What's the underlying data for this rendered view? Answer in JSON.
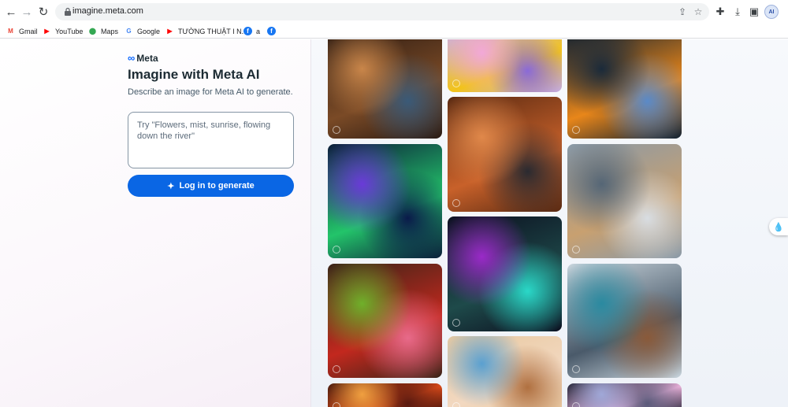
{
  "browser": {
    "url": "imagine.meta.com",
    "bookmarks": [
      {
        "label": "Gmail",
        "icon": "gmail-icon",
        "color": "#ea4335",
        "glyph": "M"
      },
      {
        "label": "YouTube",
        "icon": "youtube-icon",
        "color": "#ff0000",
        "glyph": "▶"
      },
      {
        "label": "Maps",
        "icon": "maps-icon",
        "color": "#34a853",
        "glyph": "⬤"
      },
      {
        "label": "Google",
        "icon": "google-icon",
        "color": "#4285f4",
        "glyph": "G"
      },
      {
        "label": "TƯỜNG THUẬT I N...",
        "icon": "youtube-icon",
        "color": "#ff0000",
        "glyph": "▶"
      },
      {
        "label": "a",
        "icon": "facebook-icon",
        "color": "#1877f2",
        "glyph": "f"
      },
      {
        "label": "",
        "icon": "facebook-icon",
        "color": "#1877f2",
        "glyph": "f"
      }
    ]
  },
  "left_panel": {
    "brand": "Meta",
    "title": "Imagine with Meta AI",
    "subtitle": "Describe an image for Meta AI to generate.",
    "prompt_placeholder": "Try \"Flowers, mist, sunrise, flowing down the river\"",
    "login_button": "Log in to generate"
  },
  "gallery": {
    "items": [
      {
        "subject": "library",
        "colors": [
          "#2a1a12",
          "#7a4a26",
          "#c9864a",
          "#3a5a78"
        ]
      },
      {
        "subject": "aurora",
        "colors": [
          "#0b1e3a",
          "#23c46a",
          "#6a3ad8",
          "#0a1a4a"
        ]
      },
      {
        "subject": "fruit platter",
        "colors": [
          "#3a2418",
          "#c2281e",
          "#6fb02a",
          "#e86a8a"
        ]
      },
      {
        "subject": "lanterns",
        "colors": [
          "#3a0e08",
          "#d84a1a",
          "#f0a040",
          "#5a1a10"
        ]
      },
      {
        "subject": "ducks",
        "colors": [
          "#c8b0e6",
          "#f2c31a",
          "#f2a8d8",
          "#8a6ad8"
        ]
      },
      {
        "subject": "desert car",
        "colors": [
          "#5a2a12",
          "#c8612a",
          "#e0884a",
          "#2a2a30"
        ]
      },
      {
        "subject": "astronauts",
        "colors": [
          "#0c1020",
          "#1e4a4a",
          "#9a2ac8",
          "#2ad8c8"
        ]
      },
      {
        "subject": "bird character",
        "colors": [
          "#e9c9a0",
          "#f2d8c0",
          "#5aa0d0",
          "#b07040"
        ]
      },
      {
        "subject": "butterfly",
        "colors": [
          "#102030",
          "#e8861a",
          "#1a2a3a",
          "#5a8ac8"
        ]
      },
      {
        "subject": "dog in water",
        "colors": [
          "#8a9aa8",
          "#c8a070",
          "#556676",
          "#d8dde2"
        ]
      },
      {
        "subject": "city car",
        "colors": [
          "#c8d4dc",
          "#4a5a6a",
          "#2a8aa0",
          "#8a5a3a"
        ]
      },
      {
        "subject": "bubble",
        "colors": [
          "#1a1a2a",
          "#e8b0d8",
          "#a0a8d8",
          "#5a5a7a"
        ]
      }
    ]
  }
}
